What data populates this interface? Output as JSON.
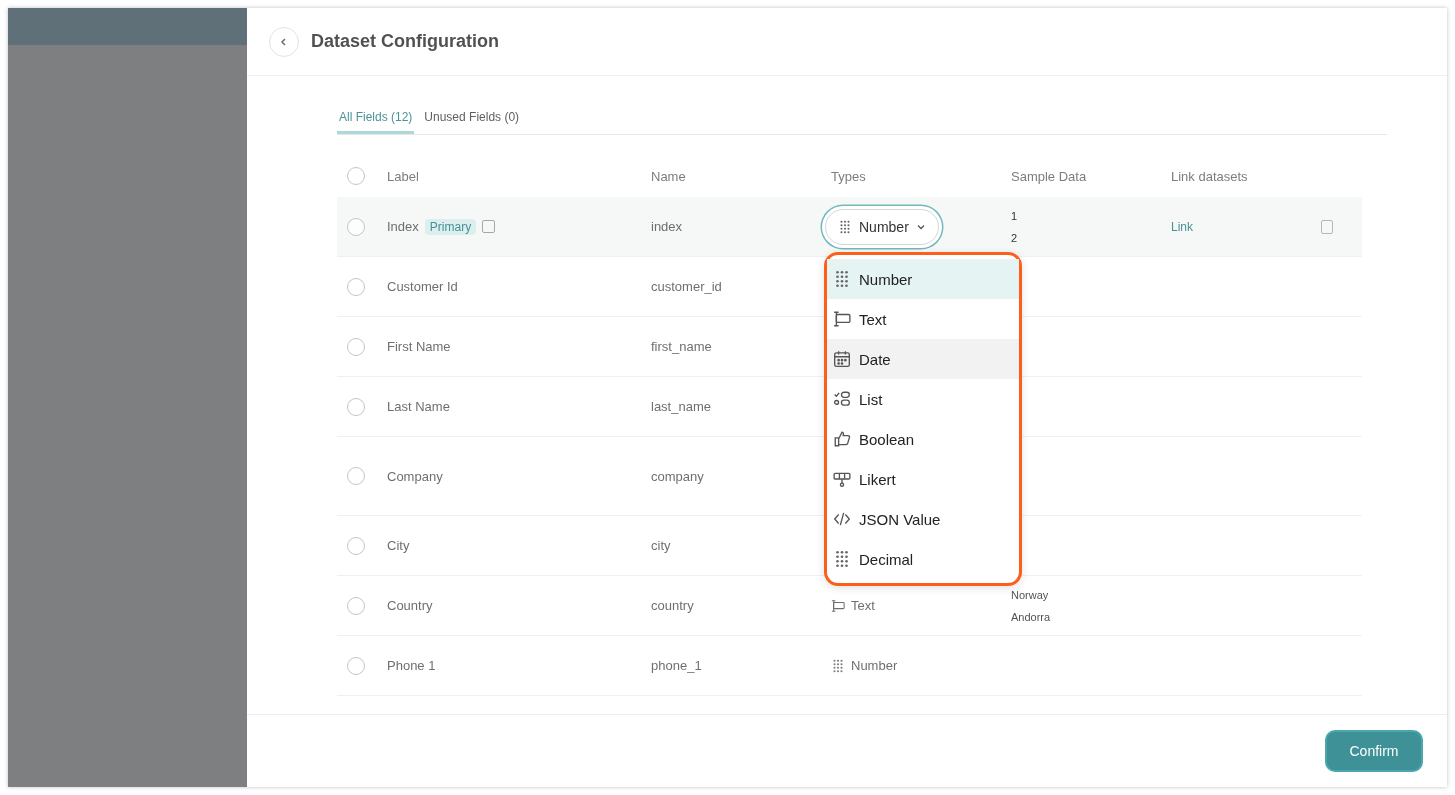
{
  "drawer": {
    "title": "Dataset Configuration"
  },
  "tabs": [
    {
      "label": "All Fields (12)",
      "selected": true
    },
    {
      "label": "Unused Fields (0)",
      "selected": false
    }
  ],
  "table": {
    "header_checked": false,
    "columns": [
      "Label",
      "Name",
      "Types",
      "Sample Data",
      "Link datasets"
    ],
    "rows": [
      {
        "label": "Index",
        "badge": "Primary",
        "name": "index",
        "type": {
          "label": "Number",
          "kind": "number",
          "open": true
        },
        "samples": [
          "1",
          "2"
        ],
        "link": "Link",
        "highlighted": true,
        "checked": false
      },
      {
        "label": "Customer Id",
        "name": "customer_id",
        "samples": [],
        "highlighted": false,
        "checked": false
      },
      {
        "label": "First Name",
        "name": "first_name",
        "samples": [],
        "highlighted": false,
        "checked": false
      },
      {
        "label": "Last Name",
        "name": "last_name",
        "samples": [],
        "highlighted": false,
        "checked": false
      },
      {
        "label": "Company",
        "name": "company",
        "samples": [],
        "highlighted": false,
        "checked": false
      },
      {
        "label": "City",
        "name": "city",
        "samples": [],
        "highlighted": false,
        "checked": false
      },
      {
        "label": "Country",
        "name": "country",
        "type": {
          "label": "Text",
          "kind": "text",
          "open": false
        },
        "samples": [
          "Norway",
          "Andorra"
        ],
        "highlighted": false,
        "checked": false
      },
      {
        "label": "Phone 1",
        "name": "phone_1",
        "type": {
          "label": "Number",
          "kind": "number",
          "open": false
        },
        "samples": [],
        "highlighted": false,
        "checked": false
      }
    ]
  },
  "type_menu": [
    {
      "label": "Number",
      "kind": "number",
      "selected": true,
      "hovered": false
    },
    {
      "label": "Text",
      "kind": "text",
      "selected": false,
      "hovered": false
    },
    {
      "label": "Date",
      "kind": "date",
      "selected": false,
      "hovered": true
    },
    {
      "label": "List",
      "kind": "list",
      "selected": false,
      "hovered": false
    },
    {
      "label": "Boolean",
      "kind": "boolean",
      "selected": false,
      "hovered": false
    },
    {
      "label": "Likert",
      "kind": "likert",
      "selected": false,
      "hovered": false
    },
    {
      "label": "JSON Value",
      "kind": "json",
      "selected": false,
      "hovered": false
    },
    {
      "label": "Decimal",
      "kind": "decimal",
      "selected": false,
      "hovered": false
    }
  ],
  "footer": {
    "button": "Confirm"
  }
}
